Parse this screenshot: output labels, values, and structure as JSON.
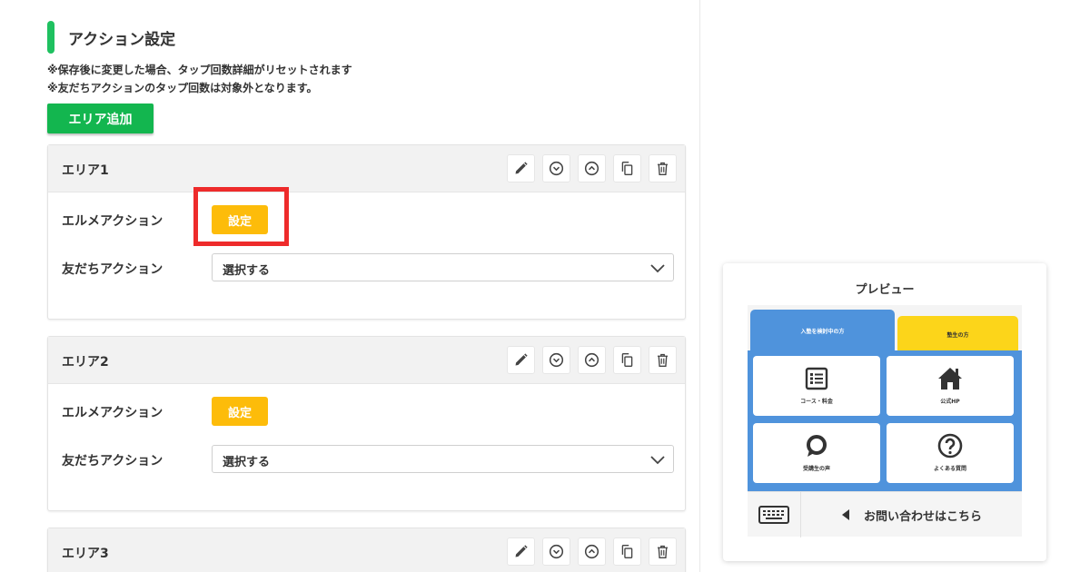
{
  "section": {
    "title": "アクション設定",
    "notes": [
      "※保存後に変更した場合、タップ回数詳細がリセットされます",
      "※友だちアクションのタップ回数は対象外となります。"
    ],
    "add_button": "エリア追加"
  },
  "areas": [
    {
      "name": "エリア1",
      "elme_label": "エルメアクション",
      "set_label": "設定",
      "friend_label": "友だちアクション",
      "select_value": "選択する"
    },
    {
      "name": "エリア2",
      "elme_label": "エルメアクション",
      "set_label": "設定",
      "friend_label": "友だちアクション",
      "select_value": "選択する"
    },
    {
      "name": "エリア3"
    }
  ],
  "tool_icons": [
    "pencil-icon",
    "chevron-down-circle-icon",
    "chevron-up-circle-icon",
    "copy-icon",
    "trash-icon"
  ],
  "preview": {
    "title": "プレビュー",
    "tabs": [
      "入塾を検討中の方",
      "塾生の方"
    ],
    "cards": [
      "コース・料金",
      "公式HP",
      "受講生の声",
      "よくある質問"
    ],
    "contact_label": "お問い合わせはこちら"
  },
  "colors": {
    "accent_green": "#13b64f",
    "set_button_yellow": "#fdbc0a",
    "highlight_red": "#ee2b2b",
    "menu_blue": "#4f93dc",
    "tab_yellow": "#fcd51a"
  }
}
